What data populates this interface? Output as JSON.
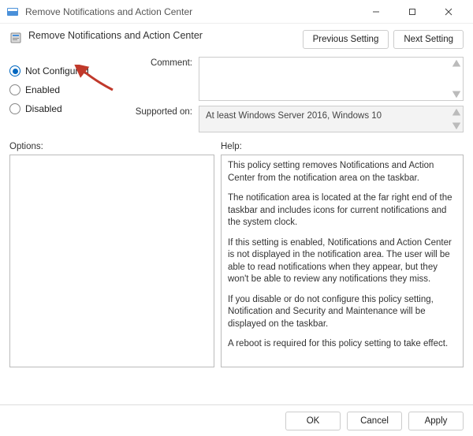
{
  "window": {
    "title": "Remove Notifications and Action Center"
  },
  "header": {
    "title": "Remove Notifications and Action Center"
  },
  "nav": {
    "prev": "Previous Setting",
    "next": "Next Setting"
  },
  "radios": {
    "not_configured": "Not Configured",
    "enabled": "Enabled",
    "disabled": "Disabled"
  },
  "fields": {
    "comment_label": "Comment:",
    "comment_value": "",
    "supported_label": "Supported on:",
    "supported_value": "At least Windows Server 2016, Windows 10"
  },
  "main": {
    "options_label": "Options:",
    "help_label": "Help:",
    "help": {
      "p1": "This policy setting removes Notifications and Action Center from the notification area on the taskbar.",
      "p2": "The notification area is located at the far right end of the taskbar and includes icons for current notifications and the system clock.",
      "p3": "If this setting is enabled, Notifications and Action Center is not displayed in the notification area. The user will be able to read notifications when they appear, but they won't be able to review any notifications they miss.",
      "p4": "If you disable or do not configure this policy setting, Notification and Security and Maintenance will be displayed on the taskbar.",
      "p5": "A reboot is required for this policy setting to take effect."
    }
  },
  "footer": {
    "ok": "OK",
    "cancel": "Cancel",
    "apply": "Apply"
  },
  "colors": {
    "accent": "#0067C0",
    "arrow": "#C0392B"
  }
}
